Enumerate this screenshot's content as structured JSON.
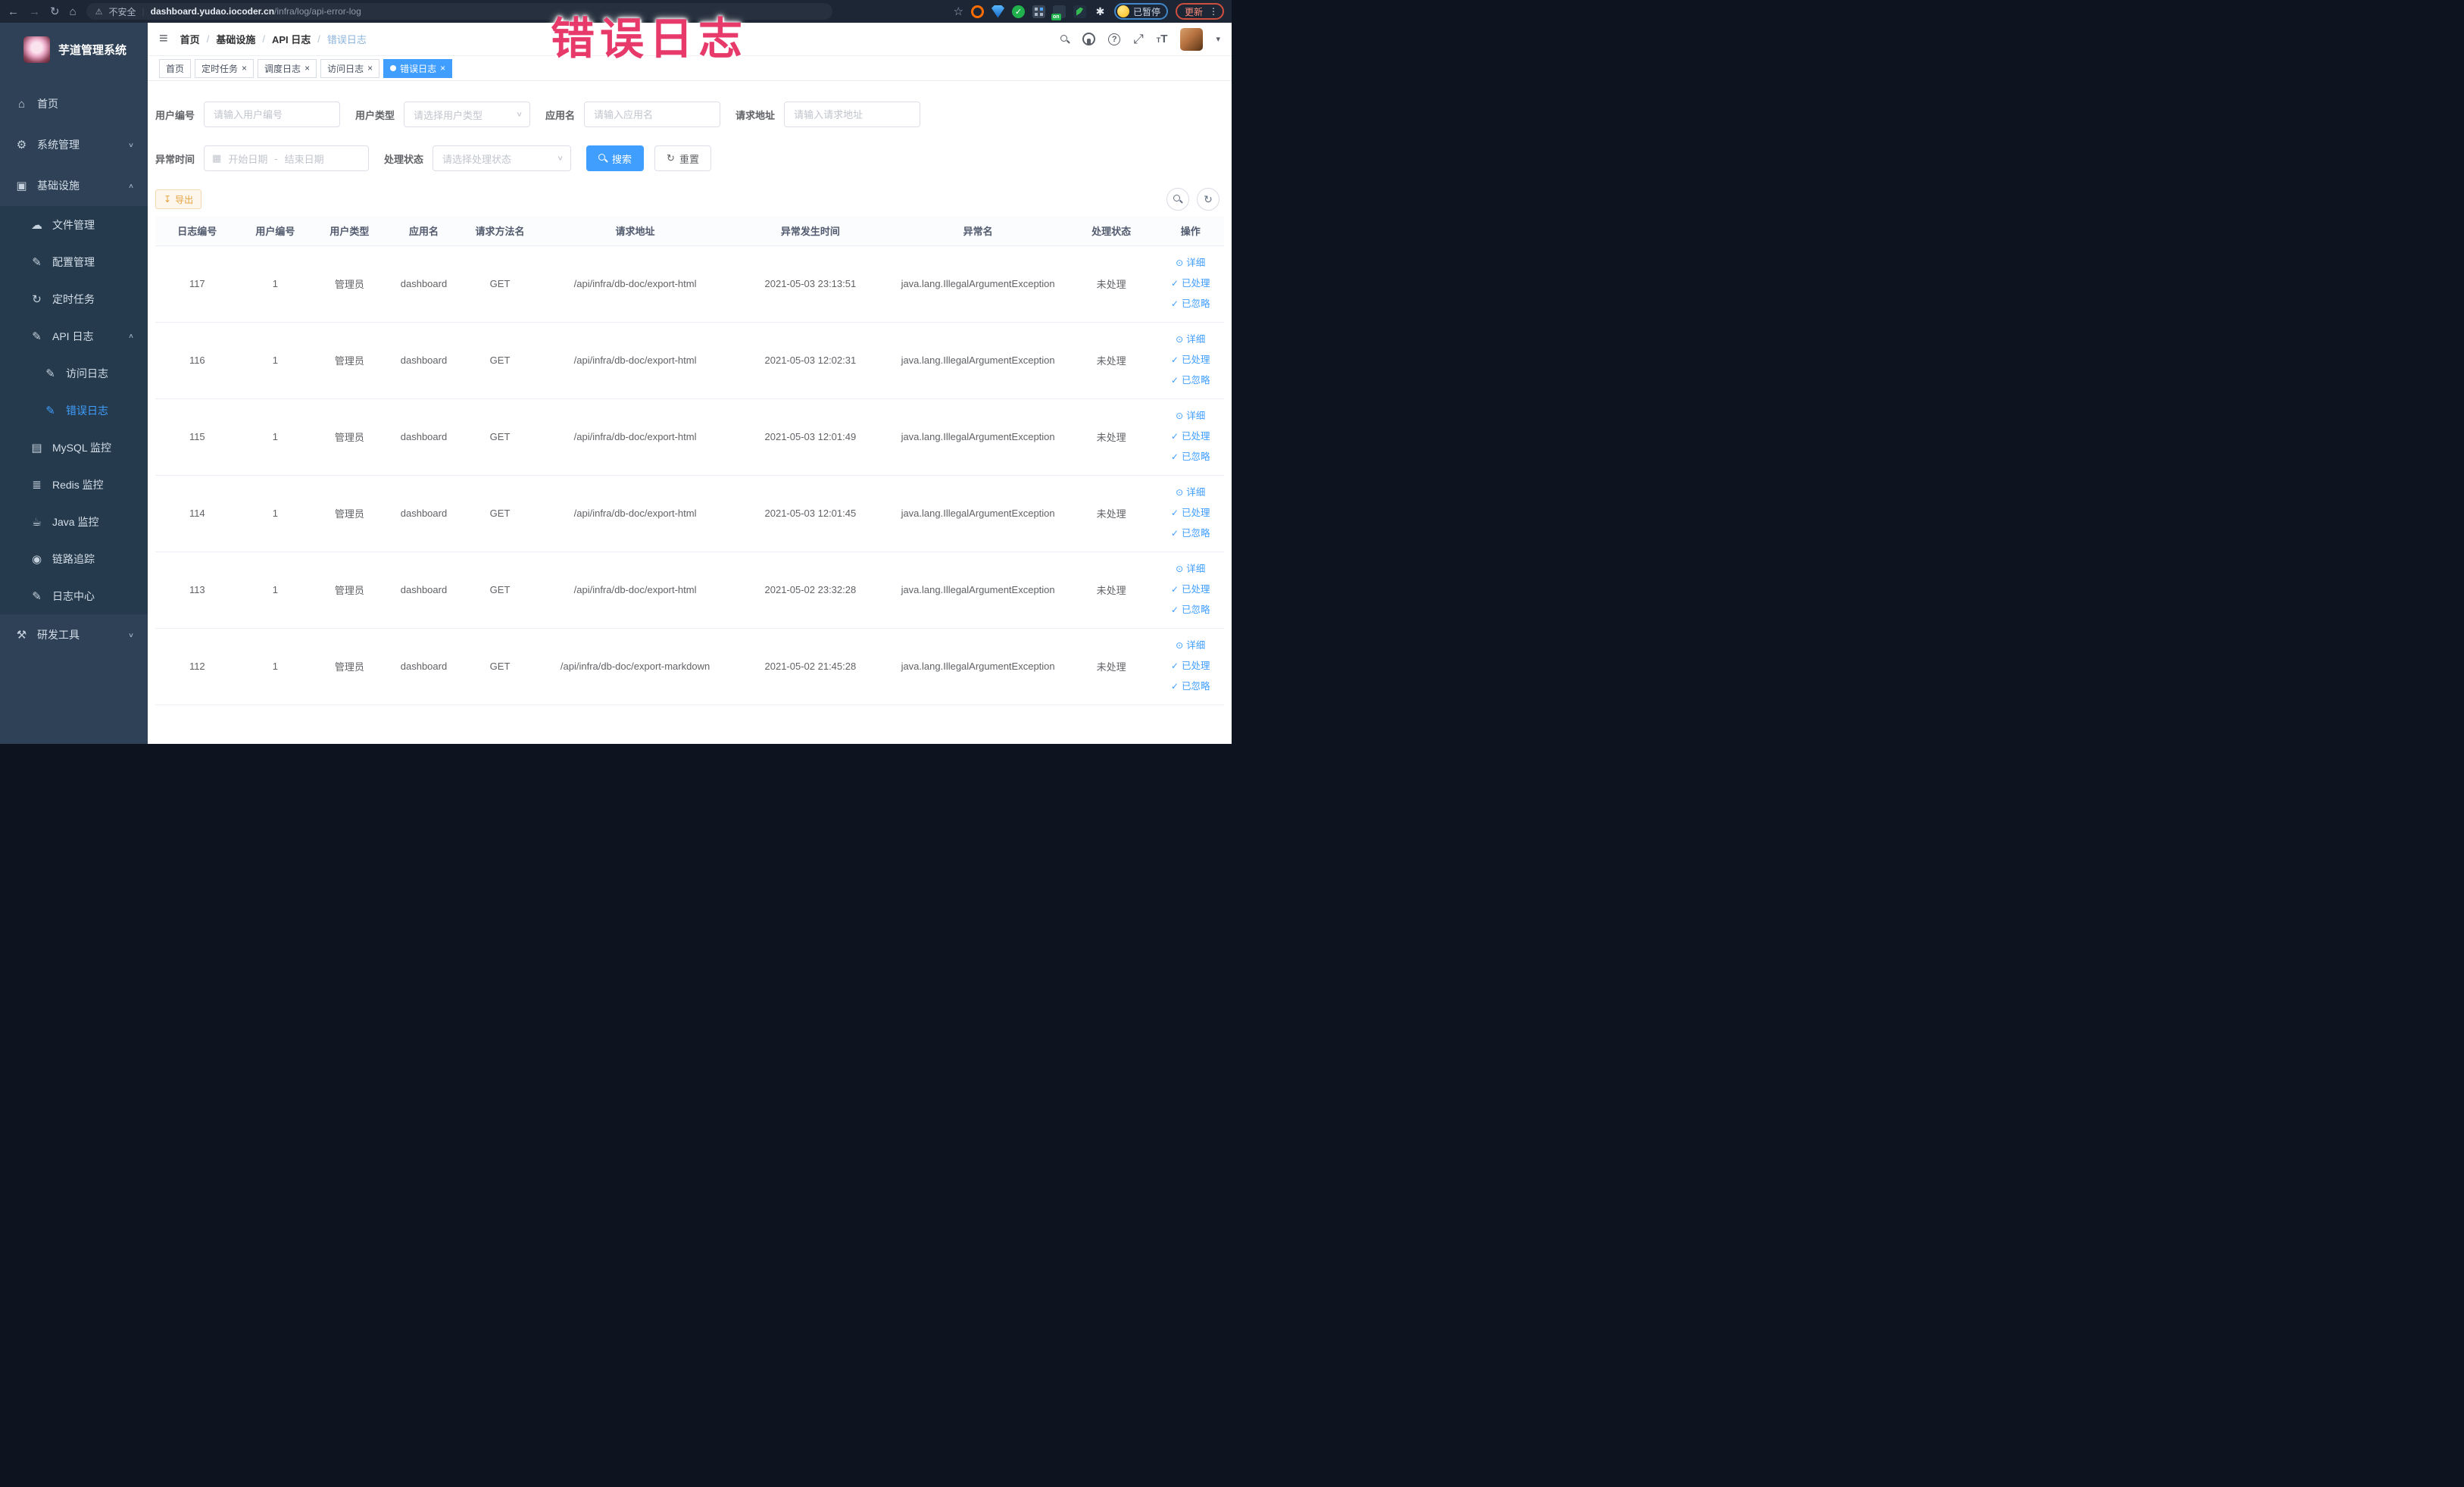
{
  "browser": {
    "security_label": "不安全",
    "url_host": "dashboard.yudao.iocoder.cn",
    "url_path": "/infra/log/api-error-log",
    "extension_on_badge": "on",
    "profile_badge": "已暂停",
    "update_button": "更新"
  },
  "annotation": {
    "text": "错误日志",
    "color": "#e8396b"
  },
  "colors": {
    "primary": "#409EFF",
    "warning": "#E6A23C",
    "sidebar_bg": "#2f4156",
    "sidebar_sub_bg": "#253a4c",
    "annotation": "#e8396b"
  },
  "sidebar": {
    "title": "芋道管理系统",
    "items": [
      {
        "label": "首页",
        "icon": "home",
        "level": 0
      },
      {
        "label": "系统管理",
        "icon": "gear",
        "level": 0,
        "arrow": "down"
      },
      {
        "label": "基础设施",
        "icon": "infra",
        "level": 0,
        "arrow": "up"
      },
      {
        "label": "文件管理",
        "icon": "cloud",
        "level": 1
      },
      {
        "label": "配置管理",
        "icon": "edit",
        "level": 1
      },
      {
        "label": "定时任务",
        "icon": "history",
        "level": 1
      },
      {
        "label": "API 日志",
        "icon": "edit",
        "level": 1,
        "arrow": "up"
      },
      {
        "label": "访问日志",
        "icon": "edit",
        "level": 2
      },
      {
        "label": "错误日志",
        "icon": "edit",
        "level": 2,
        "active": true
      },
      {
        "label": "MySQL 监控",
        "icon": "mysql",
        "level": 1
      },
      {
        "label": "Redis 监控",
        "icon": "redis",
        "level": 1
      },
      {
        "label": "Java 监控",
        "icon": "java",
        "level": 1
      },
      {
        "label": "链路追踪",
        "icon": "trace",
        "level": 1
      },
      {
        "label": "日志中心",
        "icon": "edit",
        "level": 1
      },
      {
        "label": "研发工具",
        "icon": "tool",
        "level": 0,
        "arrow": "down"
      }
    ]
  },
  "header": {
    "breadcrumb": [
      {
        "label": "首页"
      },
      {
        "label": "基础设施"
      },
      {
        "label": "API 日志"
      },
      {
        "label": "错误日志",
        "current": true
      }
    ]
  },
  "tabs": [
    {
      "label": "首页"
    },
    {
      "label": "定时任务",
      "closable": true
    },
    {
      "label": "调度日志",
      "closable": true
    },
    {
      "label": "访问日志",
      "closable": true
    },
    {
      "label": "错误日志",
      "closable": true,
      "active": true
    }
  ],
  "filters": {
    "user_id": {
      "label": "用户编号",
      "placeholder": "请输入用户编号"
    },
    "user_type": {
      "label": "用户类型",
      "placeholder": "请选择用户类型"
    },
    "app_name": {
      "label": "应用名",
      "placeholder": "请输入应用名"
    },
    "request_url": {
      "label": "请求地址",
      "placeholder": "请输入请求地址"
    },
    "exception_time": {
      "label": "异常时间",
      "start": "开始日期",
      "separator": "-",
      "end": "结束日期"
    },
    "process_status": {
      "label": "处理状态",
      "placeholder": "请选择处理状态"
    },
    "search_label": "搜索",
    "reset_label": "重置"
  },
  "toolbar": {
    "export_label": "导出"
  },
  "table": {
    "columns": [
      {
        "label": "日志编号"
      },
      {
        "label": "用户编号"
      },
      {
        "label": "用户类型"
      },
      {
        "label": "应用名"
      },
      {
        "label": "请求方法名"
      },
      {
        "label": "请求地址"
      },
      {
        "label": "异常发生时间"
      },
      {
        "label": "异常名"
      },
      {
        "label": "处理状态"
      },
      {
        "label": "操作"
      }
    ],
    "actions": [
      "详细",
      "已处理",
      "已忽略"
    ],
    "rows": [
      {
        "id": "117",
        "user_id": "1",
        "user_type": "管理员",
        "app": "dashboard",
        "method": "GET",
        "url": "/api/infra/db-doc/export-html",
        "time": "2021-05-03 23:13:51",
        "exception": "java.lang.IllegalArgumentException",
        "status": "未处理"
      },
      {
        "id": "116",
        "user_id": "1",
        "user_type": "管理员",
        "app": "dashboard",
        "method": "GET",
        "url": "/api/infra/db-doc/export-html",
        "time": "2021-05-03 12:02:31",
        "exception": "java.lang.IllegalArgumentException",
        "status": "未处理"
      },
      {
        "id": "115",
        "user_id": "1",
        "user_type": "管理员",
        "app": "dashboard",
        "method": "GET",
        "url": "/api/infra/db-doc/export-html",
        "time": "2021-05-03 12:01:49",
        "exception": "java.lang.IllegalArgumentException",
        "status": "未处理"
      },
      {
        "id": "114",
        "user_id": "1",
        "user_type": "管理员",
        "app": "dashboard",
        "method": "GET",
        "url": "/api/infra/db-doc/export-html",
        "time": "2021-05-03 12:01:45",
        "exception": "java.lang.IllegalArgumentException",
        "status": "未处理"
      },
      {
        "id": "113",
        "user_id": "1",
        "user_type": "管理员",
        "app": "dashboard",
        "method": "GET",
        "url": "/api/infra/db-doc/export-html",
        "time": "2021-05-02 23:32:28",
        "exception": "java.lang.IllegalArgumentException",
        "status": "未处理"
      },
      {
        "id": "112",
        "user_id": "1",
        "user_type": "管理员",
        "app": "dashboard",
        "method": "GET",
        "url": "/api/infra/db-doc/export-markdown",
        "time": "2021-05-02 21:45:28",
        "exception": "java.lang.IllegalArgumentException",
        "status": "未处理"
      }
    ]
  },
  "icons": {
    "back": "←",
    "forward": "→",
    "reload": "↻",
    "home_nav": "⌂",
    "warning": "⚠",
    "star": "☆",
    "kebab": "⋮",
    "check": "✓",
    "hamburger": "≡",
    "question": "?",
    "fullscreen": "⤢",
    "caret_down": "▾",
    "slash": "/",
    "pipe": "|",
    "down": "∨",
    "up": "∧",
    "home": "⌂",
    "gear": "⚙",
    "infra": "▣",
    "cloud": "☁",
    "edit": "✎",
    "history": "↻",
    "mysql": "▤",
    "redis": "≣",
    "java": "☕",
    "trace": "◉",
    "tool": "⚒",
    "eye": "⊙",
    "calendar": "▦",
    "download": "↧",
    "refresh": "↻",
    "font_large": "T",
    "font_small": "T",
    "close": "×",
    "dash": "-"
  }
}
